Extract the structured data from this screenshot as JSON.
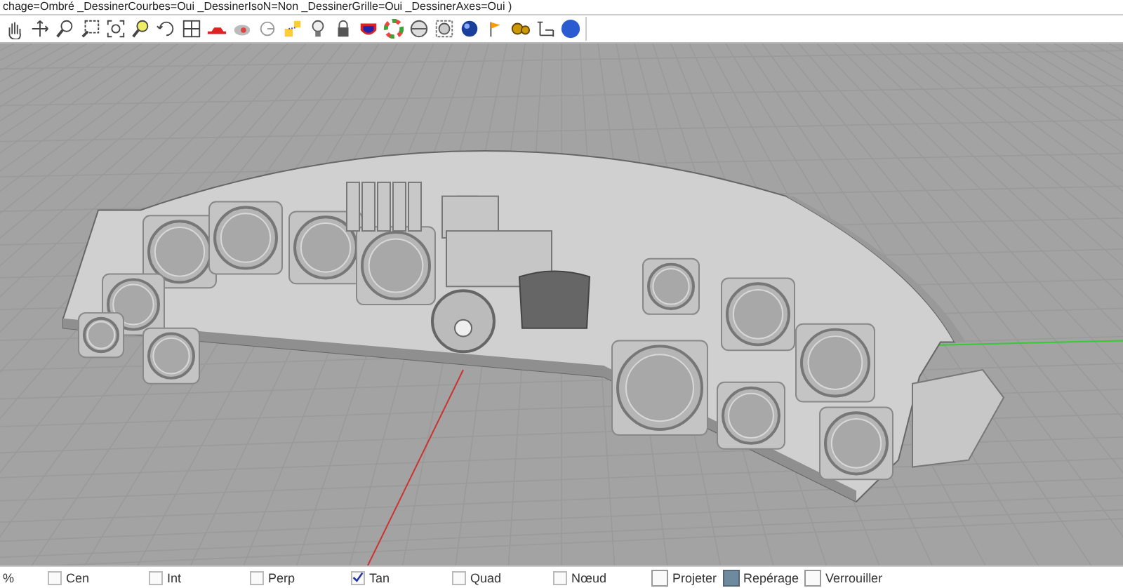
{
  "command_line": {
    "text": "chage=Ombré _DessinerCourbes=Oui _DessinerIsoN=Non _DessinerGrille=Oui _DessinerAxes=Oui )"
  },
  "status_bar": {
    "lead": "%",
    "items": [
      {
        "label": "Cen",
        "kind": "osnap",
        "checked": false
      },
      {
        "label": "Int",
        "kind": "osnap",
        "checked": false
      },
      {
        "label": "Perp",
        "kind": "osnap",
        "checked": false
      },
      {
        "label": "Tan",
        "kind": "osnap",
        "checked": true
      },
      {
        "label": "Quad",
        "kind": "osnap",
        "checked": false
      },
      {
        "label": "Nœud",
        "kind": "osnap",
        "checked": false
      },
      {
        "label": "Projeter",
        "kind": "toggle",
        "checked": false
      },
      {
        "label": "Repérage",
        "kind": "toggle",
        "checked": true
      },
      {
        "label": "Verrouiller",
        "kind": "toggle",
        "checked": false
      }
    ]
  }
}
